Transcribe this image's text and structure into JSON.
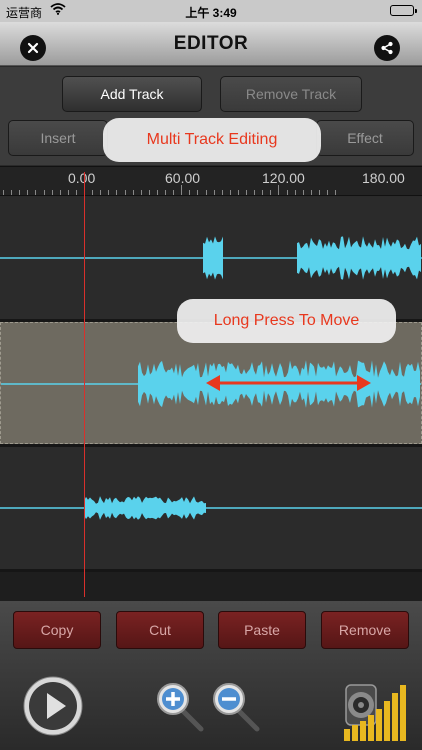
{
  "status_bar": {
    "carrier": "运营商",
    "time": "上午 3:49"
  },
  "nav": {
    "title": "EDITOR",
    "close_icon": "close-icon",
    "share_icon": "share-icon"
  },
  "toolbar": {
    "add_track": "Add Track",
    "remove_track": "Remove Track",
    "insert": "Insert",
    "effect": "Effect"
  },
  "tooltips": {
    "multi_track": "Multi Track Editing",
    "long_press": "Long Press To Move"
  },
  "timeline": {
    "labels": [
      "0.00",
      "60.00",
      "120.00",
      "180.00"
    ]
  },
  "edit_buttons": {
    "copy": "Copy",
    "cut": "Cut",
    "paste": "Paste",
    "remove": "Remove"
  },
  "controls": {
    "play_icon": "play-icon",
    "zoom_in_icon": "zoom-in-icon",
    "zoom_out_icon": "zoom-out-icon",
    "speaker_icon": "speaker-volume-icon"
  },
  "colors": {
    "waveform": "#5ad2ec",
    "playhead": "#d9302c",
    "tooltip_text": "#e8381e",
    "edit_button": "#6e1c1c"
  }
}
